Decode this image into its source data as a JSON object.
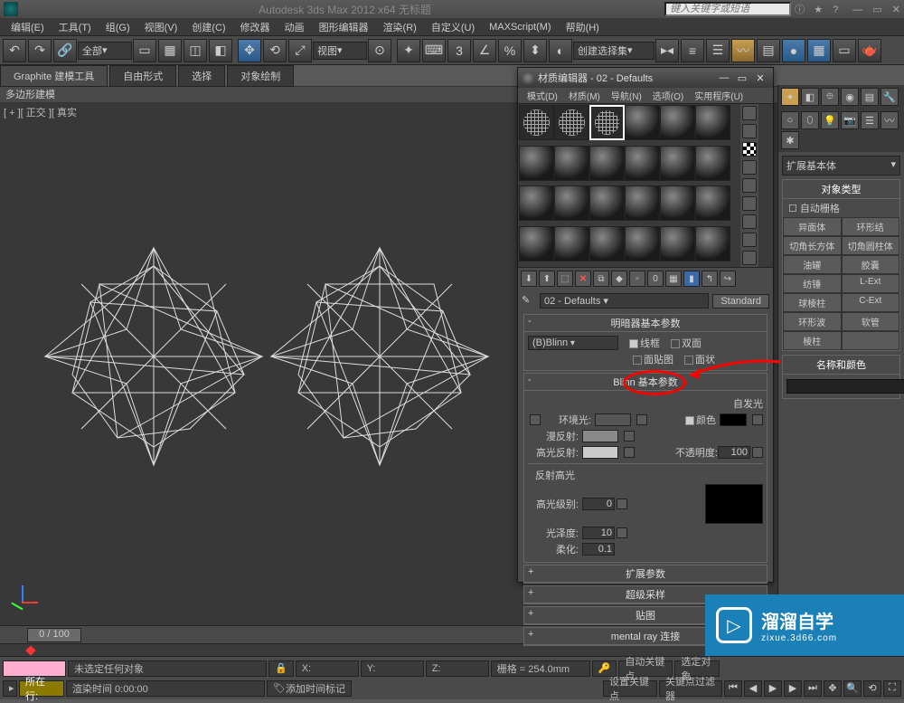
{
  "title": "Autodesk 3ds Max  2012  x64    无标题",
  "search_placeholder": "键入关键字或短语",
  "menu": [
    "编辑(E)",
    "工具(T)",
    "组(G)",
    "视图(V)",
    "创建(C)",
    "修改器",
    "动画",
    "图形编辑器",
    "渲染(R)",
    "自定义(U)",
    "MAXScript(M)",
    "帮助(H)"
  ],
  "toolbar": {
    "all": "全部",
    "view": "视图",
    "selset": "创建选择集"
  },
  "ribbon": {
    "tabs": [
      "Graphite 建模工具",
      "自由形式",
      "选择",
      "对象绘制"
    ],
    "sub": "多边形建模"
  },
  "viewport": {
    "label": "[ + ][ 正交 ][ 真实"
  },
  "time": {
    "slider": "0 / 100"
  },
  "status": {
    "no_sel": "未选定任何对象",
    "render_time": "渲染时间  0:00:00",
    "x": "X:",
    "y": "Y:",
    "z": "Z:",
    "grid": "栅格 = 254.0mm",
    "now": "所在行:",
    "add_marker": "添加时间标记",
    "autokey": "自动关键点",
    "setkey": "设置关键点",
    "keyfilter": "关键点过滤器",
    "selkey": "选定对象"
  },
  "cmd": {
    "drop": "扩展基本体",
    "sec1": "对象类型",
    "autogrid": "自动栅格",
    "buttons": [
      "异面体",
      "环形结",
      "切角长方体",
      "切角圆柱体",
      "油罐",
      "胶囊",
      "纺锤",
      "L-Ext",
      "球棱柱",
      "C-Ext",
      "环形波",
      "软管",
      "棱柱",
      ""
    ],
    "sec2": "名称和颜色"
  },
  "mat": {
    "title": "材质编辑器 - 02 - Defaults",
    "menu": [
      "模式(D)",
      "材质(M)",
      "导航(N)",
      "选项(O)",
      "实用程序(U)"
    ],
    "name": "02 - Defaults",
    "type": "Standard",
    "r_shader": "明暗器基本参数",
    "shader": "(B)Blinn",
    "wire": "线框",
    "two": "双面",
    "facemap": "面贴图",
    "faceted": "面状",
    "r_blinn": "Blinn 基本参数",
    "selfillum": "自发光",
    "color": "颜色",
    "ambient": "环境光:",
    "diffuse": "漫反射:",
    "specular": "高光反射:",
    "opacity": "不透明度:",
    "opv": "100",
    "r_spec": "反射高光",
    "speclevel": "高光级别:",
    "gloss": "光泽度:",
    "soften": "柔化:",
    "sl": "0",
    "gl": "10",
    "sf": "0.1",
    "r_ext": "扩展参数",
    "r_ss": "超级采样",
    "r_maps": "贴图",
    "r_mr": "mental ray 连接"
  },
  "watermark": {
    "big": "溜溜自学",
    "url": "zixue.3d66.com"
  }
}
